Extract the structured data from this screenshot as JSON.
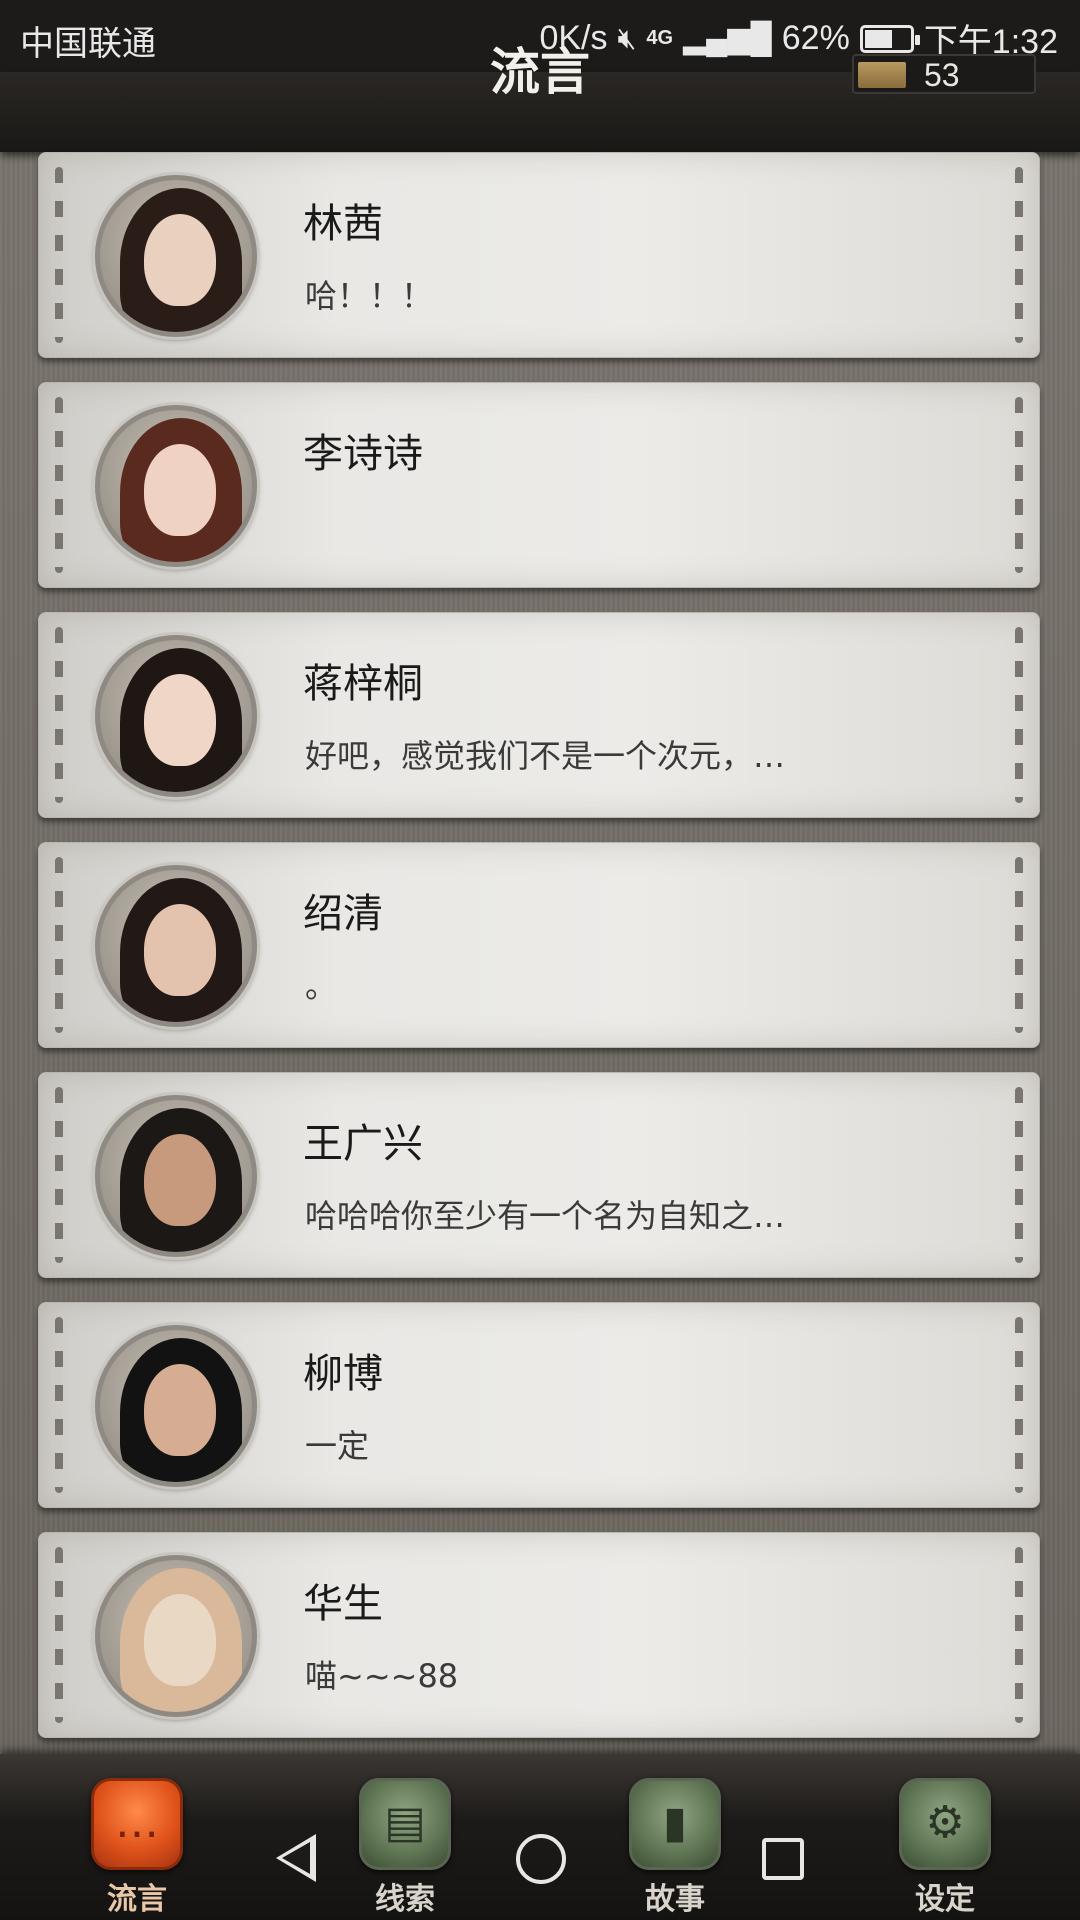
{
  "status_bar": {
    "carrier": "中国联通",
    "net_speed": "0K/s",
    "mute_icon": "mute-icon",
    "signal": "4G",
    "battery_percent": "62%",
    "battery_level": 0.62,
    "time": "下午1:32"
  },
  "header": {
    "title": "流言",
    "coin_count": "53"
  },
  "contacts": [
    {
      "name": "林茜",
      "message": "哈！！！",
      "hair": "#2a1d18",
      "skin": "#ead0bf"
    },
    {
      "name": "李诗诗",
      "message": "",
      "hair": "#5a2a1e",
      "skin": "#efd2c3"
    },
    {
      "name": "蒋梓桐",
      "message": "好吧，感觉我们不是一个次元，…",
      "hair": "#1e1714",
      "skin": "#f0d6c7"
    },
    {
      "name": "绍清",
      "message": "。",
      "hair": "#221916",
      "skin": "#e3c2ae"
    },
    {
      "name": "王广兴",
      "message": "哈哈哈你至少有一个名为自知之…",
      "hair": "#1b1816",
      "skin": "#c79a7e"
    },
    {
      "name": "柳博",
      "message": "一定",
      "hair": "#121212",
      "skin": "#d6ad93"
    },
    {
      "name": "华生",
      "message": "喵~~~88",
      "hair": "#d9b99a",
      "skin": "#e8d8c4"
    }
  ],
  "tabs": [
    {
      "label": "流言",
      "icon": "chat-bubble-icon",
      "active": true
    },
    {
      "label": "线索",
      "icon": "clue-notes-icon",
      "active": false
    },
    {
      "label": "故事",
      "icon": "story-book-icon",
      "active": false
    },
    {
      "label": "设定",
      "icon": "gear-icon",
      "active": false
    }
  ],
  "nav": {
    "back": "back-icon",
    "home": "home-icon",
    "recent": "recent-apps-icon"
  }
}
